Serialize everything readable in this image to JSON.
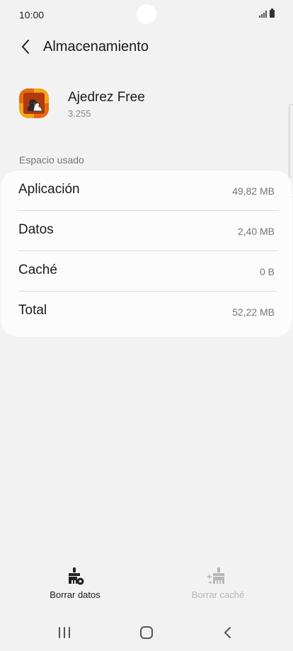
{
  "status_bar": {
    "time": "10:00"
  },
  "header": {
    "title": "Almacenamiento"
  },
  "app": {
    "name": "Ajedrez Free",
    "version": "3.255"
  },
  "section": {
    "title": "Espacio usado"
  },
  "storage": [
    {
      "label": "Aplicación",
      "value": "49,82 MB"
    },
    {
      "label": "Datos",
      "value": "2,40 MB"
    },
    {
      "label": "Caché",
      "value": "0 B"
    },
    {
      "label": "Total",
      "value": "52,22 MB"
    }
  ],
  "actions": {
    "clear_data": "Borrar datos",
    "clear_cache": "Borrar caché"
  },
  "icons": {
    "back": "chevron-left-icon",
    "clear_data": "brush-gear-icon",
    "clear_cache": "brush-sparkle-icon",
    "recents": "recents-icon",
    "home": "home-icon",
    "nav_back": "nav-back-icon"
  },
  "colors": {
    "background": "#f2f2f2",
    "card": "#fcfcfc",
    "disabled": "#b7b7b7"
  }
}
